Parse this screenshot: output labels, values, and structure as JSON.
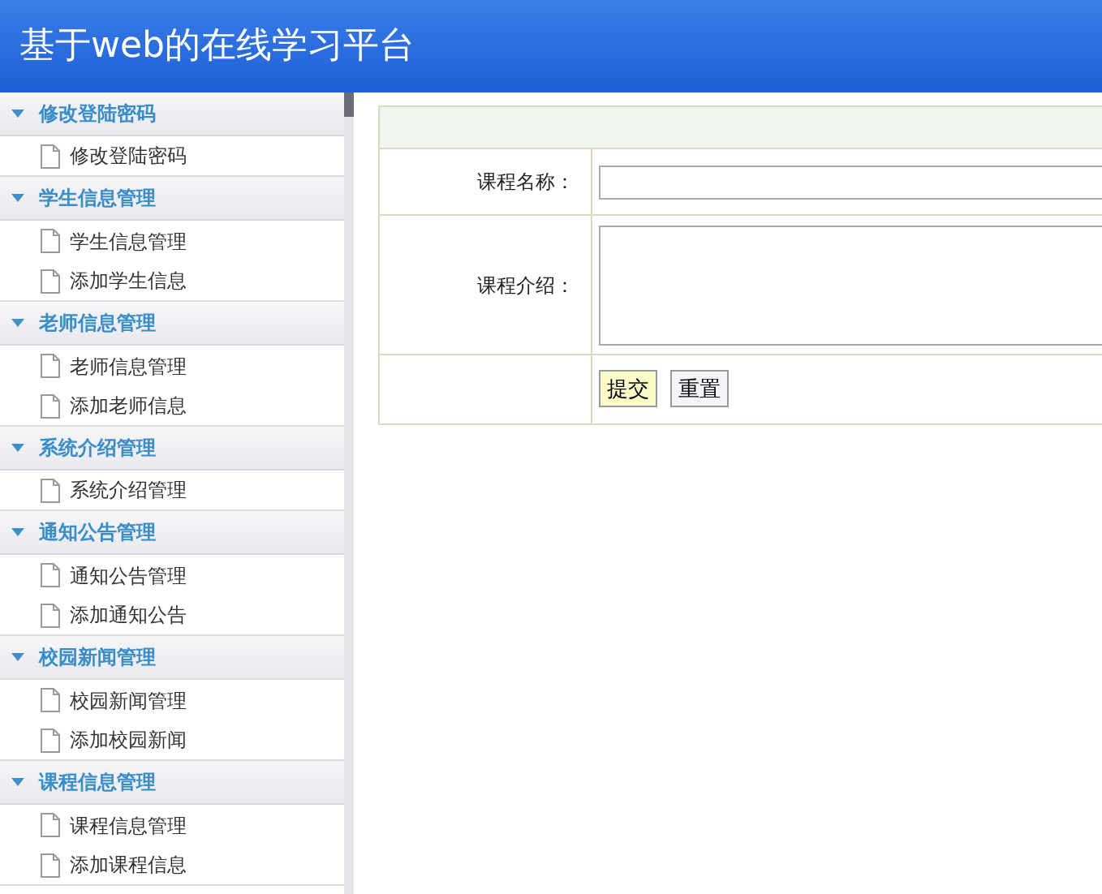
{
  "header": {
    "title": "基于web的在线学习平台"
  },
  "sidebar": {
    "groups": [
      {
        "title": "修改登陆密码",
        "expanded": true,
        "items": [
          "修改登陆密码"
        ]
      },
      {
        "title": "学生信息管理",
        "expanded": true,
        "items": [
          "学生信息管理",
          "添加学生信息"
        ]
      },
      {
        "title": "老师信息管理",
        "expanded": true,
        "items": [
          "老师信息管理",
          "添加老师信息"
        ]
      },
      {
        "title": "系统介绍管理",
        "expanded": true,
        "items": [
          "系统介绍管理"
        ]
      },
      {
        "title": "通知公告管理",
        "expanded": true,
        "items": [
          "通知公告管理",
          "添加通知公告"
        ]
      },
      {
        "title": "校园新闻管理",
        "expanded": true,
        "items": [
          "校园新闻管理",
          "添加校园新闻"
        ]
      },
      {
        "title": "课程信息管理",
        "expanded": true,
        "items": [
          "课程信息管理",
          "添加课程信息"
        ]
      }
    ]
  },
  "form": {
    "fields": [
      {
        "label": "课程名称：",
        "kind": "input"
      },
      {
        "label": "课程介绍：",
        "kind": "textarea"
      }
    ],
    "buttons": [
      {
        "label": "提交",
        "hovered": true
      },
      {
        "label": "重置",
        "hovered": false
      }
    ]
  }
}
